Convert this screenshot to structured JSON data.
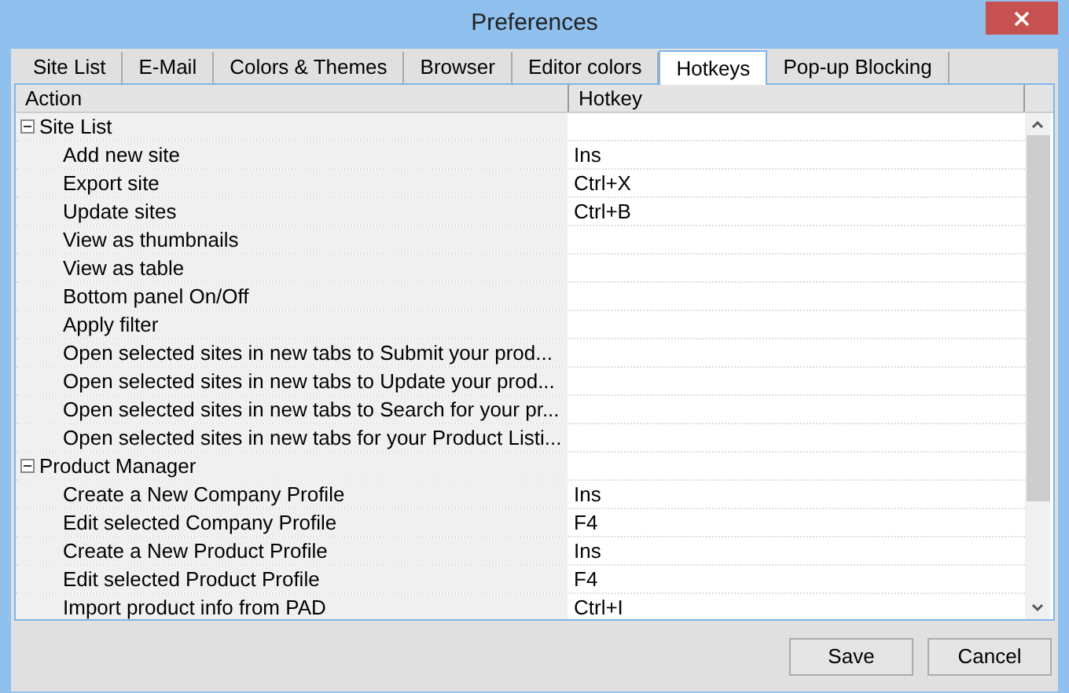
{
  "window": {
    "title": "Preferences"
  },
  "tabs": [
    {
      "label": "Site List",
      "selected": false
    },
    {
      "label": "E-Mail",
      "selected": false
    },
    {
      "label": "Colors & Themes",
      "selected": false
    },
    {
      "label": "Browser",
      "selected": false
    },
    {
      "label": "Editor colors",
      "selected": false
    },
    {
      "label": "Hotkeys",
      "selected": true
    },
    {
      "label": "Pop-up Blocking",
      "selected": false
    }
  ],
  "table": {
    "columns": [
      "Action",
      "Hotkey"
    ],
    "groups": [
      {
        "label": "Site List",
        "expanded": true,
        "children": [
          {
            "action": "Add new site",
            "hotkey": "Ins"
          },
          {
            "action": "Export site",
            "hotkey": "Ctrl+X"
          },
          {
            "action": "Update sites",
            "hotkey": "Ctrl+B"
          },
          {
            "action": "View as thumbnails"
          },
          {
            "action": "View as table"
          },
          {
            "action": "Bottom panel On/Off"
          },
          {
            "action": "Apply filter"
          },
          {
            "action": "Open selected sites in new tabs to Submit your prod..."
          },
          {
            "action": "Open selected sites in new tabs to Update your prod..."
          },
          {
            "action": "Open selected sites in new tabs to Search for your pr..."
          },
          {
            "action": "Open selected sites in new tabs for your Product Listi..."
          }
        ]
      },
      {
        "label": "Product Manager",
        "expanded": true,
        "children": [
          {
            "action": "Create a New Company Profile",
            "hotkey": "Ins"
          },
          {
            "action": "Edit selected Company Profile",
            "hotkey": "F4"
          },
          {
            "action": "Create a New Product Profile",
            "hotkey": "Ins"
          },
          {
            "action": "Edit selected Product Profile",
            "hotkey": "F4"
          },
          {
            "action": "Import product info from PAD",
            "hotkey": "Ctrl+I"
          }
        ]
      }
    ]
  },
  "buttons": [
    "Save",
    "Cancel"
  ]
}
